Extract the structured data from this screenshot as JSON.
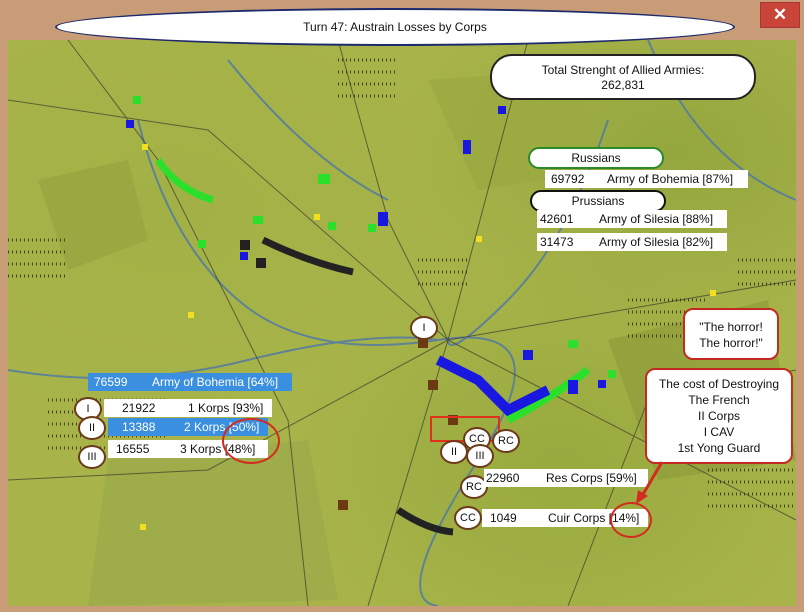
{
  "window": {
    "title": "Turn 47: Austrain Losses by Corps",
    "close_glyph": "✕"
  },
  "totals": {
    "label": "Total Strenght of Allied Armies:",
    "value": "262,831"
  },
  "allies": {
    "russians_label": "Russians",
    "russians_rows": [
      {
        "value": "69792",
        "name": "Army of Bohemia [87%]"
      }
    ],
    "prussians_label": "Prussians",
    "prussians_rows": [
      {
        "value": "42601",
        "name": "Army of Silesia [88%]"
      },
      {
        "value": "31473",
        "name": "Army of Silesia [82%]"
      }
    ]
  },
  "austrian": {
    "army": {
      "value": "76599",
      "name": "Army of Bohemia [64%]"
    },
    "corps": [
      {
        "badge": "I",
        "value": "21922",
        "name": "1 Korps [93%]"
      },
      {
        "badge": "II",
        "value": "13388",
        "name": "2 Korps [50%]"
      },
      {
        "badge": "III",
        "value": "16555",
        "name": "3 Korps [48%]"
      }
    ]
  },
  "french": {
    "res": {
      "badge": "RC",
      "value": "22960",
      "name": "Res Corps [59%]"
    },
    "cuir": {
      "badge": "CC",
      "value": "1049",
      "name": "Cuir Corps [14%]"
    }
  },
  "map_badges": {
    "i": "I",
    "ii": "II",
    "iii": "III",
    "cc": "CC",
    "rc": "RC"
  },
  "callouts": {
    "horror_line1": "\"The horror!",
    "horror_line2": "The horror!\"",
    "cost_lines": [
      "The cost of Destroying",
      "The French",
      "II Corps",
      "I CAV",
      "1st Yong Guard"
    ]
  },
  "colors": {
    "map_base": "#a8b44a",
    "russian_green": "#2be02b",
    "prussian_blue": "#1818e0",
    "austrian_black": "#222222",
    "french_brown": "#6b3a12",
    "highlight_red": "#d42a1f"
  }
}
